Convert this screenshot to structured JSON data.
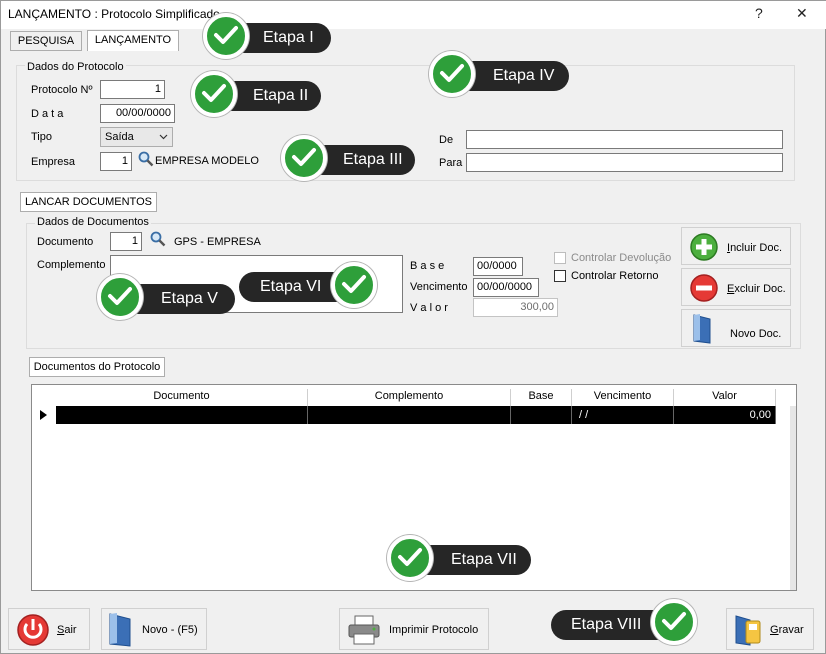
{
  "window": {
    "title": "LANÇAMENTO : Protocolo Simplificado",
    "help": "?",
    "close": "✕"
  },
  "tabs": {
    "pesquisa": "PESQUISA",
    "lancamento": "LANÇAMENTO"
  },
  "protocolo": {
    "group_title": "Dados do Protocolo",
    "protocolo_label": "Protocolo Nº",
    "protocolo_value": "1",
    "data_label": "D a t a",
    "data_value": "00/00/0000",
    "tipo_label": "Tipo",
    "tipo_value": "Saída",
    "empresa_label": "Empresa",
    "empresa_value": "1",
    "empresa_name": "EMPRESA MODELO",
    "de_label": "De",
    "de_value": "",
    "para_label": "Para",
    "para_value": ""
  },
  "lancar_tab": "LANCAR DOCUMENTOS",
  "documentos": {
    "group_title": "Dados de Documentos",
    "documento_label": "Documento",
    "documento_value": "1",
    "documento_name": "GPS - EMPRESA",
    "complemento_label": "Complemento",
    "base_label": "B a s e",
    "base_value": "00/0000",
    "vencimento_label": "Vencimento",
    "vencimento_value": "00/00/0000",
    "valor_label": "V a l o r",
    "valor_value": "300,00",
    "controlar_devolucao": "Controlar Devolução",
    "controlar_retorno": "Controlar Retorno",
    "incluir_u": "I",
    "incluir_rest": "ncluir Doc.",
    "excluir_u": "E",
    "excluir_rest": "xcluir Doc.",
    "novo_doc": "Novo Doc."
  },
  "grid": {
    "tab": "Documentos do Protocolo",
    "columns": [
      "Documento",
      "Complemento",
      "Base",
      "Vencimento",
      "Valor"
    ],
    "row": {
      "documento": "",
      "complemento": "",
      "base": "",
      "vencimento": "/ /",
      "valor": "0,00"
    }
  },
  "footer": {
    "sair_u": "S",
    "sair_rest": "air",
    "novo": "Novo - (F5)",
    "imprimir": "Imprimir Protocolo",
    "gravar_u": "G",
    "gravar_rest": "ravar"
  },
  "callouts": [
    "Etapa I",
    "Etapa II",
    "Etapa III",
    "Etapa IV",
    "Etapa V",
    "Etapa VI",
    "Etapa VII",
    "Etapa VIII"
  ],
  "colors": {
    "check_green": "#2e9f3a",
    "callout_bg": "#262626"
  }
}
